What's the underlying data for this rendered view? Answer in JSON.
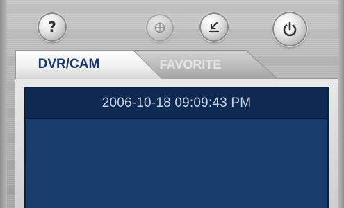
{
  "toolbar": {
    "buttons": [
      {
        "id": "help",
        "icon": "help-icon",
        "glyph": "?",
        "enabled": true
      },
      {
        "id": "ptz",
        "icon": "ptz-crosshair-icon",
        "enabled": false
      },
      {
        "id": "download",
        "icon": "download-icon",
        "enabled": true
      },
      {
        "id": "power",
        "icon": "power-icon",
        "enabled": true
      }
    ]
  },
  "tabs": [
    {
      "label": "DVR/CAM",
      "active": true
    },
    {
      "label": "FAVORITE",
      "active": false
    }
  ],
  "panel": {
    "datetime": "2006-10-18 09:09:43 PM"
  },
  "colors": {
    "panel_bg": "#173d6d",
    "panel_header_bg": "#0e2a52",
    "active_tab_text": "#1a3a72",
    "inactive_tab_text": "#e3e3e3",
    "datetime_text": "#c7d2e2"
  }
}
